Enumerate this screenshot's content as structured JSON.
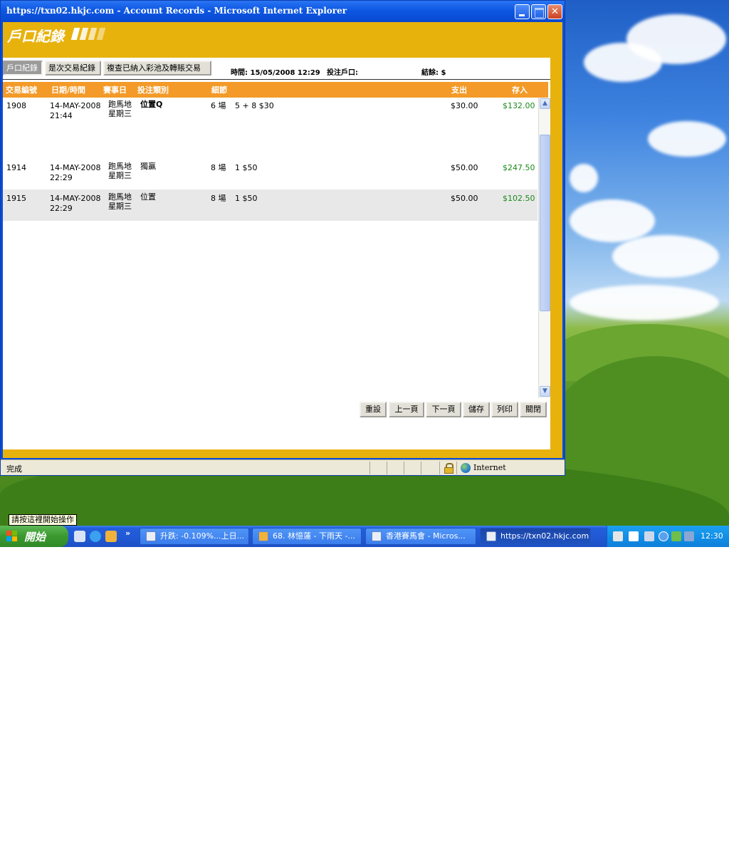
{
  "window": {
    "title": "https://txn02.hkjc.com - Account Records - Microsoft Internet Explorer"
  },
  "page": {
    "header_title": "戶口紀錄",
    "tabs": [
      {
        "label": "戶口紀錄",
        "active": true
      },
      {
        "label": "是次交易紀錄",
        "active": false
      },
      {
        "label": "複查已納入彩池及轉賬交易",
        "active": false
      }
    ],
    "time_label": "時間: 15/05/2008 12:29",
    "account_label": "投注戶口:",
    "balance_label": "結餘: $"
  },
  "table": {
    "headers": {
      "txn_no": "交易編號",
      "datetime": "日期/時間",
      "race_day": "賽事日",
      "bet_type": "投注類別",
      "details": "細節",
      "debit": "支出",
      "credit": "存入"
    },
    "rows": [
      {
        "txn_no": "1908",
        "date": "14-MAY-2008",
        "time": "21:44",
        "venue": "跑馬地",
        "weekday": "星期三",
        "bet_type": "位置Q",
        "race": "6 場",
        "detail": "5 + 8 $30",
        "debit": "$30.00",
        "credit": "$132.00"
      },
      {
        "txn_no": "1914",
        "date": "14-MAY-2008",
        "time": "22:29",
        "venue": "跑馬地",
        "weekday": "星期三",
        "bet_type": "獨贏",
        "race": "8 場",
        "detail": "1 $50",
        "debit": "$50.00",
        "credit": "$247.50"
      },
      {
        "txn_no": "1915",
        "date": "14-MAY-2008",
        "time": "22:29",
        "venue": "跑馬地",
        "weekday": "星期三",
        "bet_type": "位置",
        "race": "8 場",
        "detail": "1 $50",
        "debit": "$50.00",
        "credit": "$102.50"
      }
    ]
  },
  "actions": {
    "reset": "重設",
    "prev": "上一頁",
    "next": "下一頁",
    "save": "儲存",
    "print": "列印",
    "close": "關閉"
  },
  "statusbar": {
    "status": "完成",
    "zone": "Internet",
    "icons": [
      "lock-icon",
      "globe-icon"
    ]
  },
  "tooltip": "請按這裡開始操作",
  "taskbar": {
    "start_label": "開始",
    "tasks": [
      {
        "label": "升跌: -0.109%...上日...",
        "active": false
      },
      {
        "label": "68. 林憶蓮 - 下雨天 -...",
        "active": false
      },
      {
        "label": "香港賽馬會 - Micros...",
        "active": false
      },
      {
        "label": "https://txn02.hkjc.com ...",
        "active": true
      }
    ],
    "clock": "12:30"
  },
  "colors": {
    "page_bg": "#e8b20d",
    "table_header": "#f39a28",
    "credit_text": "#1a8a1a",
    "titlebar": "#0d57e3"
  }
}
